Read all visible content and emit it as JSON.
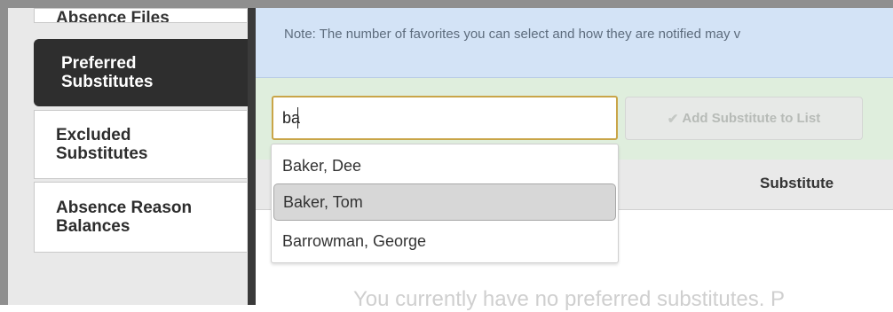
{
  "nav": {
    "items": [
      {
        "label": "Absence Files"
      },
      {
        "label": "Preferred Substitutes"
      },
      {
        "label": "Excluded Substitutes"
      },
      {
        "label": "Absence Reason Balances"
      }
    ],
    "active_index": 1
  },
  "note": {
    "text": "Note: The number of favorites you can select and how they are notified may v"
  },
  "search": {
    "value": "ba",
    "add_button_label": "Add Substitute to List",
    "add_button_icon": "checkmark-icon",
    "add_button_enabled": false
  },
  "autocomplete": {
    "options": [
      {
        "label": "Baker, Dee"
      },
      {
        "label": "Baker, Tom"
      },
      {
        "label": "Barrowman, George"
      }
    ],
    "highlighted_index": 1
  },
  "table": {
    "columns": [
      {
        "label": "Substitute"
      }
    ],
    "empty_message": "You currently have no preferred substitutes. P"
  },
  "colors": {
    "active_nav_bg": "#2e2e2e",
    "note_bg": "#d3e3f6",
    "search_bar_bg": "#dfeedd",
    "input_border": "#c9a548"
  }
}
